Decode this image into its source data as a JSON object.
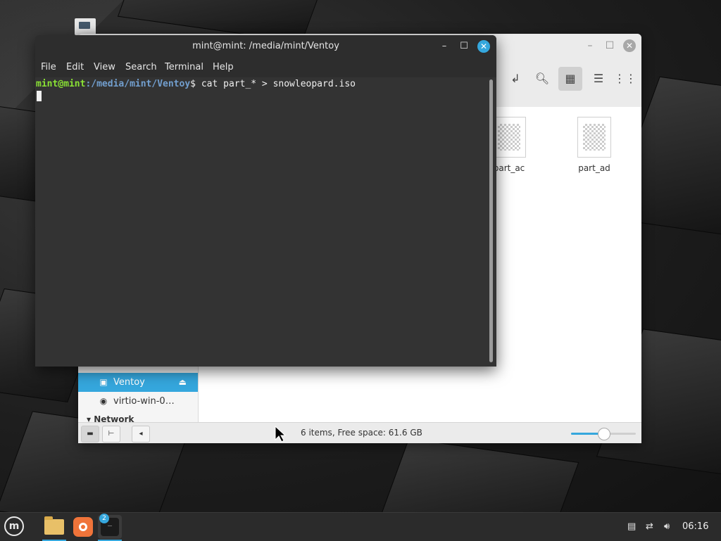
{
  "terminal": {
    "title": "mint@mint: /media/mint/Ventoy",
    "menu": [
      "File",
      "Edit",
      "View",
      "Search",
      "Terminal",
      "Help"
    ],
    "prompt_user": "mint@mint",
    "prompt_path": ":/media/mint/Ventoy",
    "prompt_symbol": "$",
    "command": " cat part_* > snowleopard.iso"
  },
  "file_manager": {
    "files": [
      {
        "name": "part_ac"
      },
      {
        "name": "part_ad"
      }
    ],
    "sidebar": {
      "items": [
        {
          "label": "Ventoy",
          "icon": "drive-icon",
          "selected": true
        },
        {
          "label": "virtio-win-0…",
          "icon": "disc-icon",
          "selected": false
        }
      ],
      "network_header": "Network"
    },
    "status_text": "6 items, Free space: 61.6 GB",
    "zoom_level": 0.5
  },
  "taskbar": {
    "terminal_badge": "2",
    "clock": "06:16"
  },
  "colors": {
    "accent": "#35a7dd",
    "prompt_user": "#8ae234",
    "prompt_path": "#729fcf",
    "terminal_bg": "#333333"
  }
}
